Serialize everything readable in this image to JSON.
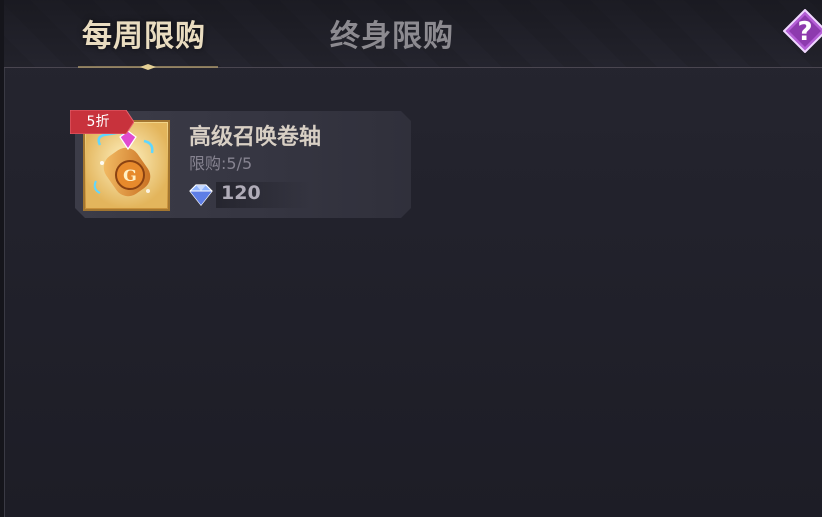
{
  "tabs": {
    "weekly": "每周限购",
    "lifetime": "终身限购"
  },
  "help": {
    "glyph": "?"
  },
  "items": [
    {
      "name": "高级召唤卷轴",
      "discount": "5折",
      "limit_label": "限购:5/5",
      "price": "120",
      "currency_icon": "diamond-icon",
      "item_icon": "summon-scroll-icon"
    }
  ],
  "colors": {
    "discount_tag": "#c8323c",
    "active_tab": "#e9dcc0",
    "inactive_tab": "#8c8a90",
    "help_button": "#a24ec0"
  }
}
